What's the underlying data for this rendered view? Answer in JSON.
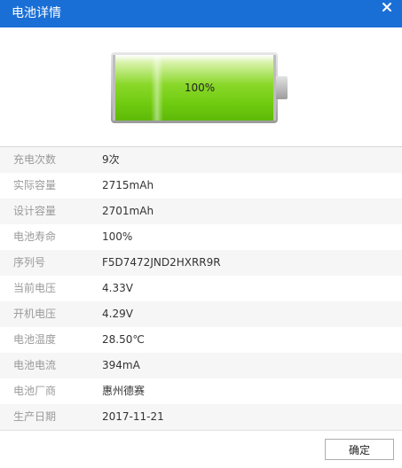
{
  "window": {
    "title": "电池详情",
    "close_icon": "close-icon"
  },
  "battery": {
    "percent_label": "100%",
    "charge_level": 1.0,
    "fill_color": "#7fd21b",
    "icon": "battery-icon"
  },
  "details": [
    {
      "label": "充电次数",
      "value": "9次"
    },
    {
      "label": "实际容量",
      "value": "2715mAh"
    },
    {
      "label": "设计容量",
      "value": "2701mAh"
    },
    {
      "label": "电池寿命",
      "value": "100%"
    },
    {
      "label": "序列号",
      "value": "F5D7472JND2HXRR9R"
    },
    {
      "label": "当前电压",
      "value": "4.33V"
    },
    {
      "label": "开机电压",
      "value": "4.29V"
    },
    {
      "label": "电池温度",
      "value": "28.50℃"
    },
    {
      "label": "电池电流",
      "value": "394mA"
    },
    {
      "label": "电池厂商",
      "value": "惠州德赛"
    },
    {
      "label": "生产日期",
      "value": "2017-11-21"
    }
  ],
  "footer": {
    "ok_label": "确定"
  },
  "colors": {
    "titlebar": "#1a6fd6",
    "row_alt": "#f6f6f6"
  }
}
